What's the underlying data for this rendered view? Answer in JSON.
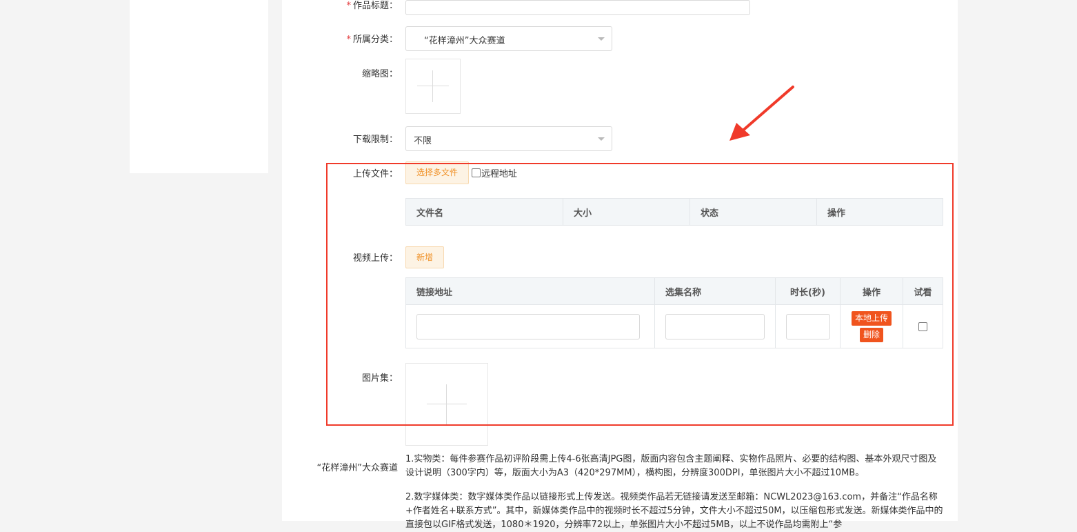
{
  "form": {
    "title_label": "作品标题：",
    "title_star": "*",
    "category_label": "所属分类：",
    "category_star": "*",
    "category_value": "“花样漳州”大众赛道",
    "thumbnail_label": "缩略图：",
    "download_limit_label": "下载限制：",
    "download_limit_value": "不限",
    "upload_file_label": "上传文件：",
    "select_files_button": "选择多文件",
    "remote_address_label": "远程地址",
    "file_table_headers": [
      "文件名",
      "大小",
      "状态",
      "操作"
    ],
    "video_upload_label": "视频上传：",
    "add_button": "新增",
    "video_table_headers": [
      "链接地址",
      "选集名称",
      "时长(秒)",
      "操作",
      "试看"
    ],
    "video_row": {
      "link_value": "",
      "episode_value": "",
      "duration_value": "",
      "local_upload_button": "本地上传",
      "delete_button": "删除"
    },
    "gallery_label": "图片集："
  },
  "notes": {
    "track_label": "“花样漳州”大众赛道",
    "paragraph1": "1.实物类：每件参赛作品初评阶段需上传4-6张高清JPG图，版面内容包含主题阐释、实物作品照片、必要的结构图、基本外观尺寸图及设计说明（300字内）等，版面大小为A3（420*297MM），横构图，分辨度300DPI，单张图片大小不超过10MB。",
    "paragraph2": "2.数字媒体类：数字媒体类作品以链接形式上传发送。视频类作品若无链接请发送至邮箱：NCWL2023@163.com，并备注“作品名称+作者姓名+联系方式”。其中，新媒体类作品中的视频时长不超过5分钟，文件大小不超过50M，以压缩包形式发送。新媒体类作品中的直接包以GIF格式发送，1080＊1920，分辨率72以上，单张图片大小不超过5MB，以上不说作品均需附上“参"
  },
  "colors": {
    "required": "#e4393c",
    "accent_orange": "#f0932b",
    "danger_button": "#f0541e",
    "annotation_red": "#f03a2a"
  }
}
